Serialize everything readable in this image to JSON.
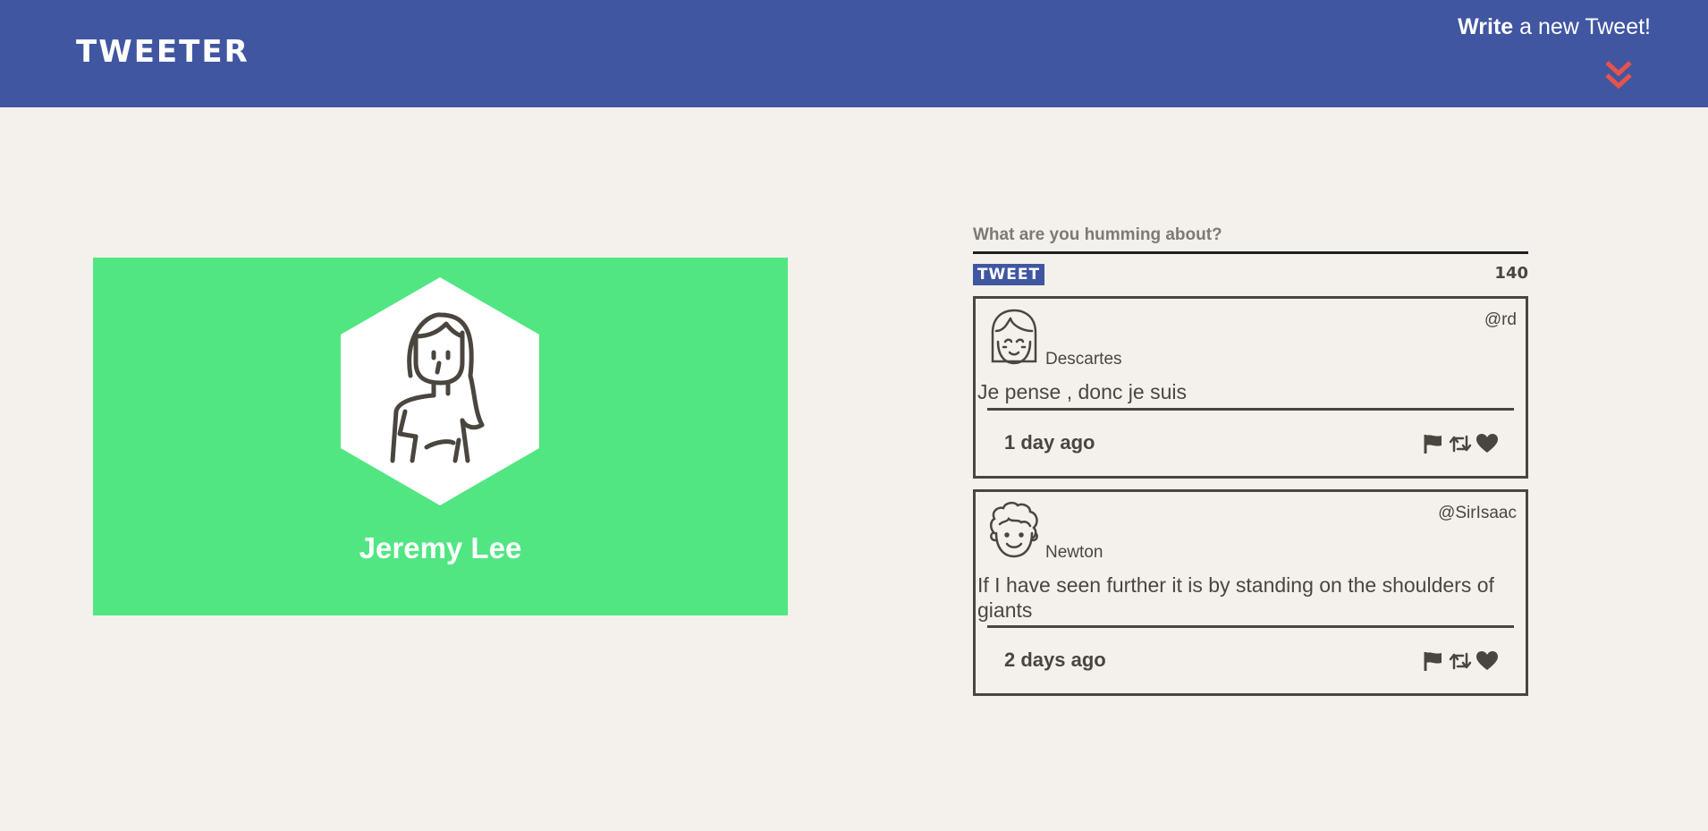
{
  "header": {
    "logo": "TWEETER",
    "compose_bold": "Write",
    "compose_rest": " a new Tweet!",
    "compose_icon": "double-chevron-down-icon"
  },
  "profile": {
    "name": "Jeremy Lee",
    "avatar_icon": "female-avatar-icon"
  },
  "composer": {
    "placeholder": "What are you humming about?",
    "value": "",
    "button_label": "TWEET",
    "counter": "140"
  },
  "tweets": [
    {
      "avatar_icon": "bob-hair-avatar-icon",
      "handle": "@rd",
      "name": "Descartes",
      "content": "Je pense , donc je suis",
      "time": "1 day ago",
      "actions": [
        "flag-icon",
        "retweet-icon",
        "heart-icon"
      ]
    },
    {
      "avatar_icon": "curly-hair-avatar-icon",
      "handle": "@SirIsaac",
      "name": "Newton",
      "content": "If I have seen further it is by standing on the shoulders of giants",
      "time": "2 days ago",
      "actions": [
        "flag-icon",
        "retweet-icon",
        "heart-icon"
      ]
    }
  ],
  "colors": {
    "nav": "#4056a1",
    "background": "#f4f1ec",
    "profile_card": "#51e682",
    "accent_chevron": "#e8534a",
    "text": "#4a463f"
  }
}
